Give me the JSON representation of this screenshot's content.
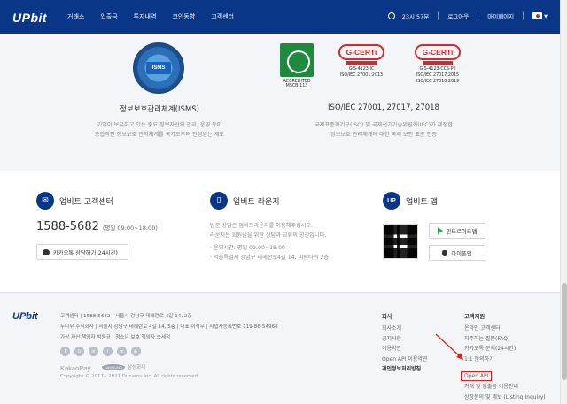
{
  "header": {
    "logo": "UPbit",
    "nav": [
      "거래소",
      "입출금",
      "투자내역",
      "코인동향",
      "고객센터"
    ],
    "clock": "23시 57분",
    "logout": "로그아웃",
    "mypage": "마이페이지"
  },
  "cert": {
    "isms_badge": "ISMS",
    "isms_title": "정보보호관리체계(ISMS)",
    "isms_desc_1": "기업이 보유하고 있는 중요 정보자산의 관리, 운영 등의",
    "isms_desc_2": "종합적인 정보보호 관리체계를 국가로부터 인정받는 제도",
    "accredited": "ACCREDITED",
    "accredited_code": "MSCB-113",
    "gcert_brand": "G-CERTi",
    "gcert1_code": "GIS-4123-IC",
    "gcert1_std": "ISO/IEC 27001:2013",
    "gcert2_code": "GIS-4123-CCS-PII",
    "gcert2_std1": "ISO/IEC 27017:2015",
    "gcert2_std2": "ISO/IEC 27018:2019",
    "iso_title": "ISO/IEC 27001, 27017, 27018",
    "iso_desc_1": "국제표준화기구(ISO) 및 국제전기기술위원회(IEC)가 제정한",
    "iso_desc_2": "정보보호 관리체계에 대한 국제 보안 표준 인증"
  },
  "info": {
    "service_title": "업비트 고객센터",
    "phone": "1588-5682",
    "phone_hours": "(평일 09:00~18:00)",
    "kakao_btn": "카카오톡 상담하기(24시간)",
    "lounge_title": "업비트 라운지",
    "lounge_desc_1": "방문 상담은 업비트라운지를 이용해주십시오.",
    "lounge_desc_2": "라운지는 회원님을 위한 상담과 교류의 공간입니다.",
    "lounge_hours": "· 운영시간: 평일 09:00~18:00",
    "lounge_addr": "· 서울특별시 강남구 테헤란로4길 14, 미림타워 2층",
    "app_title": "업비트 앱",
    "android_btn": "안드로이드앱",
    "iphone_btn": "아이폰앱"
  },
  "footer": {
    "logo": "UPbit",
    "addr_line1": "고객센터   |   1588-5682   |   서울시 강남구 테헤란로 4길 14, 2층",
    "addr_line2": "두나무 주식회사   |   서울시 강남구 테헤란로 4길 14, 5층   |   대표 이석우   |   사업자등록번호 119-86-54968",
    "addr_line3": "가상 자산 책임자 박둥규   |   청소년 보호 책임자 송세정",
    "social": [
      "f",
      "b",
      "in",
      "t",
      "m",
      "▶"
    ],
    "kakaopay": "KakaoPay",
    "samsung": "SAMSUNG",
    "samsung_sub": "삼성화재",
    "copyright": "Copyright © 2017 - 2021 Dunamu Inc. All rights reserved.",
    "company_head": "회사",
    "company_links": [
      "회사소개",
      "공지사항",
      "이용약관",
      "Open API 이용약관",
      "개인정보처리방침"
    ],
    "support_head": "고객지원",
    "support_links": [
      "온라인 고객센터",
      "자주하는 질문(FAQ)",
      "카카오톡 문의(24시간)",
      "1:1 문의하기",
      "Open API",
      "거래 및 입출금 이용안내",
      "상장문의 및 제보 (Listing Inquiry)"
    ]
  },
  "colors": {
    "brand": "#093687",
    "highlight_box": "#e01f1f"
  }
}
